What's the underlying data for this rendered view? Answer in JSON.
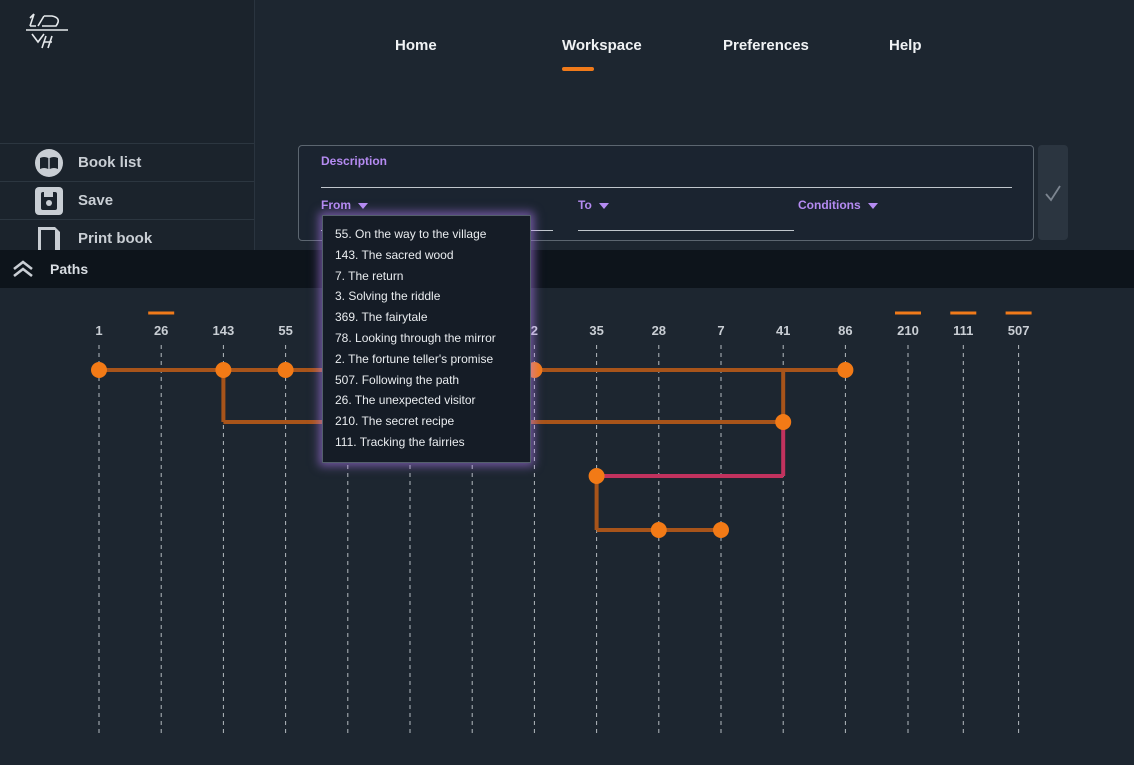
{
  "nav": {
    "items": [
      {
        "label": "Home",
        "active": false
      },
      {
        "label": "Workspace",
        "active": true
      },
      {
        "label": "Preferences",
        "active": false
      },
      {
        "label": "Help",
        "active": false
      }
    ]
  },
  "sidebar": {
    "items": [
      {
        "label": "Book list",
        "icon": "book-icon"
      },
      {
        "label": "Save",
        "icon": "save-icon"
      },
      {
        "label": "Print book",
        "icon": "print-icon"
      }
    ]
  },
  "form": {
    "description_label": "Description",
    "from_label": "From",
    "to_label": "To",
    "conditions_label": "Conditions",
    "submit_icon": "checkmark-icon"
  },
  "dropdown": {
    "items": [
      "55. On the way to the village",
      "143. The sacred wood",
      "7. The return",
      "3. Solving the riddle",
      "369. The fairytale",
      "78. Looking through the mirror",
      "2. The fortune teller's promise",
      "507. Following the path",
      "26. The unexpected visitor",
      "210. The secret recipe",
      "111. Tracking the fairries"
    ]
  },
  "paths": {
    "title": "Paths",
    "columns": [
      "1",
      "26",
      "143",
      "55",
      "3",
      "369",
      "78",
      "2",
      "35",
      "28",
      "7",
      "41",
      "86",
      "210",
      "111",
      "507"
    ],
    "marked_columns": [
      "26",
      "210",
      "111",
      "507"
    ],
    "no_dashed_line": [
      "210",
      "111",
      "507"
    ],
    "edges": [
      {
        "from": "1",
        "to": "86",
        "row": 1,
        "color": "#a8541a"
      },
      {
        "from": "143",
        "to": "41",
        "row": 2,
        "color": "#a8541a",
        "drop_from_row": 1
      },
      {
        "from": "35",
        "to": "41",
        "row": 3,
        "color": "#c2325e",
        "rise_to_row": 2
      },
      {
        "from": "35",
        "to": "7",
        "row": 4,
        "color": "#a8541a",
        "drop_from_row": 3
      }
    ],
    "nodes": [
      {
        "column": "1",
        "row": 1
      },
      {
        "column": "143",
        "row": 1
      },
      {
        "column": "55",
        "row": 1
      },
      {
        "column": "2",
        "row": 1
      },
      {
        "column": "86",
        "row": 1
      },
      {
        "column": "41",
        "row": 2
      },
      {
        "column": "35",
        "row": 3
      },
      {
        "column": "28",
        "row": 4
      },
      {
        "column": "7",
        "row": 4
      }
    ],
    "colors": {
      "node": "#f27a16",
      "accent": "#f07a1a",
      "path": "#a8541a",
      "path_pink": "#c2325e"
    }
  }
}
